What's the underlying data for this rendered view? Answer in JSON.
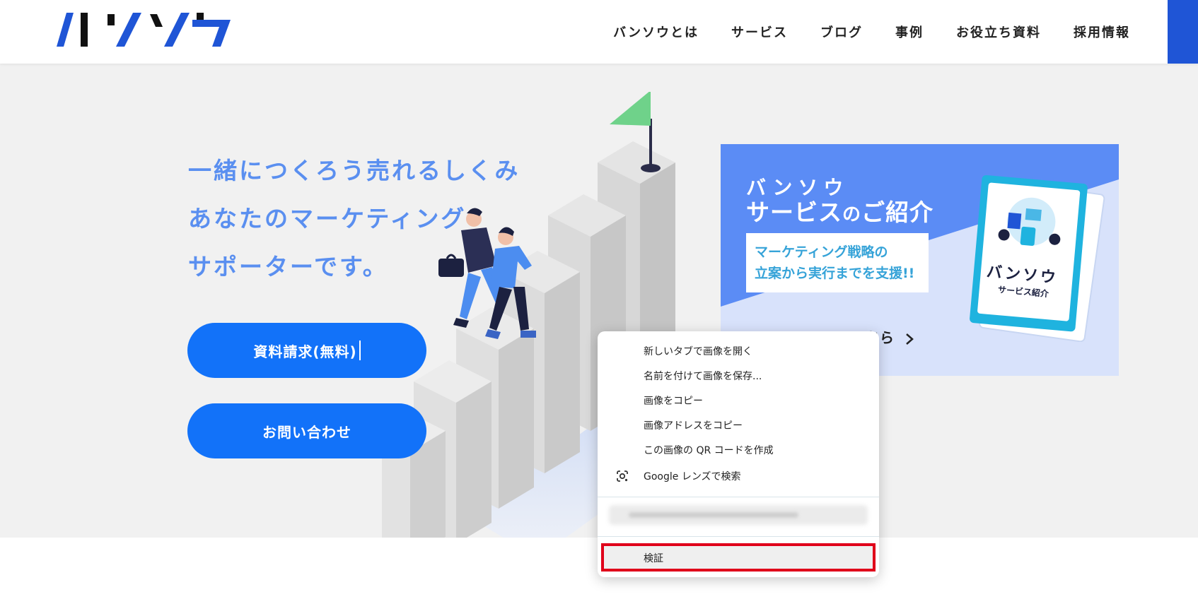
{
  "header": {
    "logo_text": "バンソウ",
    "nav": [
      {
        "label": "バンソウとは"
      },
      {
        "label": "サービス"
      },
      {
        "label": "ブログ"
      },
      {
        "label": "事例"
      },
      {
        "label": "お役立ち資料"
      },
      {
        "label": "採用情報"
      }
    ]
  },
  "hero": {
    "headline": [
      "一緒につくろう売れるしくみ",
      "あなたのマーケティング",
      "サポーターです。"
    ],
    "cta_primary": "資料請求(無料)",
    "cta_secondary": "お問い合わせ"
  },
  "banner": {
    "brand": "バンソウ",
    "title_main": "サービス",
    "title_small": "の",
    "title_end": "ご紹介",
    "box_lines": [
      "マーケティング戦略の",
      "立案から実行までを支援!!"
    ],
    "link_text": "ちら",
    "brochure_brand": "バンソウ",
    "brochure_subtitle": "サービス紹介"
  },
  "context_menu": {
    "items": [
      {
        "label": "新しいタブで画像を開く"
      },
      {
        "label": "名前を付けて画像を保存..."
      },
      {
        "label": "画像をコピー"
      },
      {
        "label": "画像アドレスをコピー"
      },
      {
        "label": "この画像の QR コードを作成"
      },
      {
        "label": "Google レンズで検索",
        "icon": "google-lens-icon"
      }
    ],
    "inspect_label": "検証"
  },
  "colors": {
    "brand_blue": "#1272f9",
    "headline_blue": "#5a8ff0",
    "header_accent": "#1f55d6",
    "highlight_red": "#e0001a"
  }
}
